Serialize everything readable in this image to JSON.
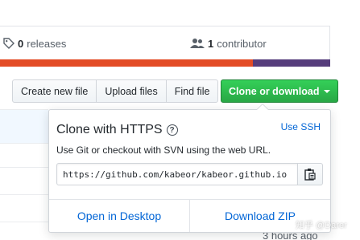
{
  "stats": {
    "releases_count": "0",
    "releases_label": "releases",
    "contributors_count": "1",
    "contributors_label": "contributor"
  },
  "language_bar": {
    "colors": [
      "#e34c26",
      "#563d7c"
    ],
    "fractions": [
      0.765,
      0.235
    ]
  },
  "toolbar": {
    "create_label": "Create new file",
    "upload_label": "Upload files",
    "find_label": "Find file",
    "clone_label": "Clone or download"
  },
  "clone_popup": {
    "title": "Clone with HTTPS",
    "help_symbol": "?",
    "use_ssh_label": "Use SSH",
    "description": "Use Git or checkout with SVN using the web URL.",
    "url": "https://github.com/kabeor/kabeor.github.io",
    "copy_icon": "clipboard-icon",
    "open_desktop_label": "Open in Desktop",
    "download_zip_label": "Download ZIP"
  },
  "file_list": {
    "last_timestamp": "3 hours ago"
  },
  "watermark": {
    "text": "知乎 @Darer"
  },
  "colors": {
    "accent_green": "#28a745",
    "link_blue": "#0366d6"
  }
}
